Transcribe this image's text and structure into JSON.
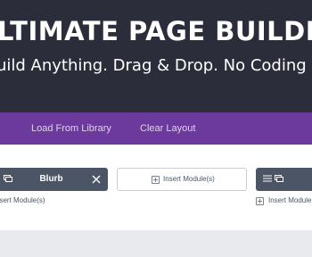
{
  "hero": {
    "title": "LTIMATE PAGE BUILDER PL",
    "subtitle": "uild Anything. Drag & Drop. No Coding Require"
  },
  "toolbar": {
    "partial_label": "",
    "load_label": "Load From Library",
    "clear_label": "Clear Layout"
  },
  "canvas": {
    "blurb_module": {
      "title": "Blurb",
      "icons": [
        "handle-icon",
        "close-icon"
      ]
    },
    "insert_button_label": "Insert Module(s)",
    "left_insert_label": "nsert Module(s)",
    "right_insert_label": "Insert Module(s)",
    "right_module_icons": [
      "menu-icon",
      "handle-icon"
    ]
  },
  "colors": {
    "hero_bg": "#2c2d3a",
    "toolbar_bg": "#6c3a9c",
    "module_bg": "#4b5565",
    "canvas_bg": "#ffffff",
    "page_bg": "#e9eaee"
  }
}
